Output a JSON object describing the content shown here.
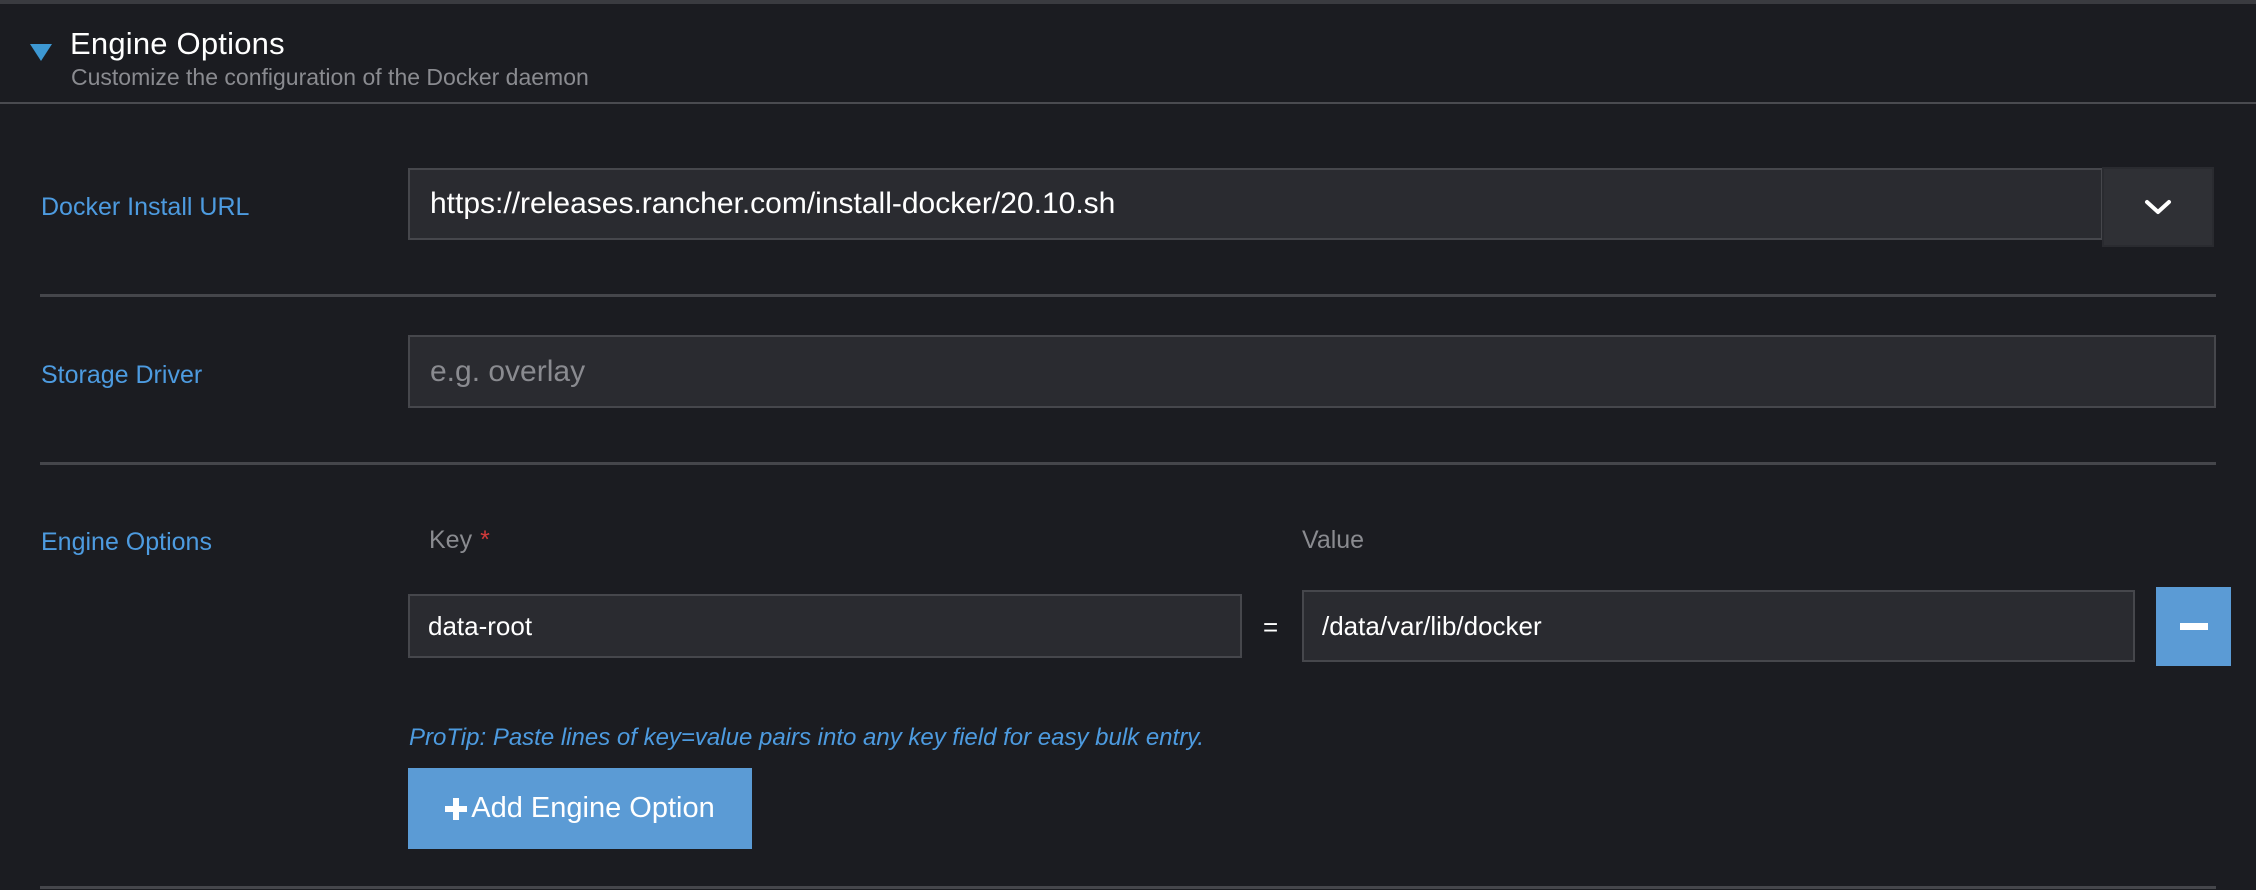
{
  "section": {
    "title": "Engine Options",
    "subtitle": "Customize the configuration of the Docker daemon",
    "collapse_icon": "caret-down-icon"
  },
  "docker_install_url": {
    "label": "Docker Install URL",
    "value": "https://releases.rancher.com/install-docker/20.10.sh",
    "dropdown_icon": "chevron-down-icon"
  },
  "storage_driver": {
    "label": "Storage Driver",
    "value": "",
    "placeholder": "e.g. overlay"
  },
  "engine_options": {
    "label": "Engine Options",
    "key_header": "Key",
    "required_marker": "*",
    "value_header": "Value",
    "equals_sign": "=",
    "rows": [
      {
        "key": "data-root",
        "value": "/data/var/lib/docker"
      }
    ],
    "remove_icon": "minus-icon",
    "protip": "ProTip: Paste lines of key=value pairs into any key field for easy bulk entry.",
    "add_button_label": "Add Engine Option",
    "add_icon": "plus-icon"
  },
  "colors": {
    "background": "#1b1c21",
    "accent": "#5b9bd5",
    "label_blue": "#4d9be0",
    "required_red": "#d23a3a"
  }
}
